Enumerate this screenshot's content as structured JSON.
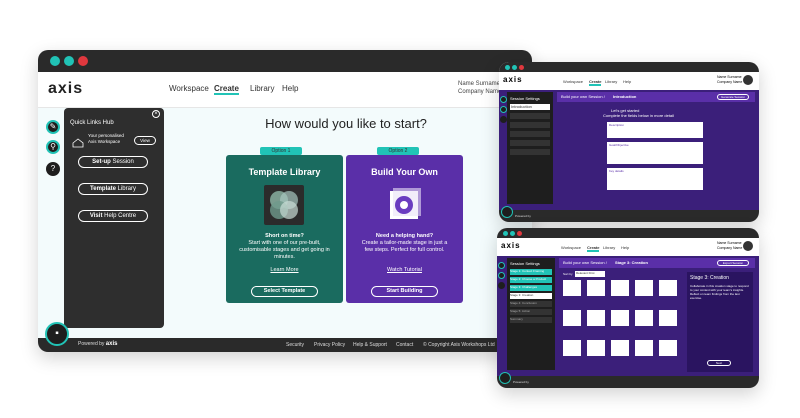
{
  "colors": {
    "teal": "#21c3b6",
    "dark": "#2a2a2a",
    "green_card": "#1a6b5f",
    "purple_card": "#5a2fa8",
    "purple_bg": "#3b1f7a",
    "light_bg": "#f3fbfc"
  },
  "main": {
    "brand": "axis",
    "nav": [
      "Workspace",
      "Create",
      "Library",
      "Help"
    ],
    "user_name": "Name Surname",
    "company_name": "Company Name",
    "heading": "How would you like to start?",
    "sidebar": {
      "title": "Quick Links Hub",
      "workspace_text": "Your personalised Axis Workspace",
      "view_btn": "View",
      "setup_bold": "Set-up",
      "setup_rest": "Session",
      "template_bold": "Template",
      "template_rest": "Library",
      "visit_bold": "Visit",
      "visit_rest": "Help Centre"
    },
    "option1": {
      "tag": "Option 1",
      "title": "Template Library",
      "bold": "Short on time?",
      "text": "Start with one of our pre-built, customisable stages and get going in minutes.",
      "link": "Learn More",
      "button": "Select Template"
    },
    "option2": {
      "tag": "Option 2",
      "title": "Build Your Own",
      "bold": "Need a helping hand?",
      "text": "Create a tailor-made stage in just a few steps. Perfect for full control.",
      "link": "Watch Tutorial",
      "button": "Start Building"
    },
    "footer": {
      "powered": "Powered by",
      "links": [
        "Security",
        "Privacy Policy",
        "Help & Support",
        "Contact",
        "© Copyright Axis Workshops Ltd"
      ]
    }
  },
  "top_right": {
    "nav": [
      "Workspace",
      "Create",
      "Library",
      "Help"
    ],
    "user": "Name Surname",
    "company": "Company Name",
    "header_plain": "Build your own Session /",
    "header_bold": "Introduction",
    "header_btn": "Generate Session",
    "sidebar_title": "Session Settings",
    "sidebar_items": [
      "Introduction",
      "",
      "",
      "",
      "",
      ""
    ],
    "prompt_line1": "Let's get started",
    "prompt_line2": "Complete the fields below in more detail",
    "fields": [
      "Description",
      "Goal/Objective",
      "Key details"
    ],
    "footer_powered": "Powered by"
  },
  "bottom_right": {
    "nav": [
      "Workspace",
      "Create",
      "Library",
      "Help"
    ],
    "user": "Name Surname",
    "company": "Company Name",
    "header_plain": "Build your own Session /",
    "header_bold": "Stage 3: Creation",
    "header_btn": "Export Session",
    "sidebar_title": "Session Settings",
    "sidebar_items": [
      "Stage 1: Context Framing",
      "Stage 2: Choose a Product",
      "Stage 3: Challenges",
      "Stage 3: Creation",
      "Stage 4: Conclusion",
      "Stage 5: Action",
      "Summary"
    ],
    "filter_label": "Sort by",
    "filter_value": "Relevant First",
    "panel_title": "Stage 3: Creation",
    "panel_text": "Collaborate in this creation stage to respond to your context with your team's insights. Reflect on team findings from the last exercise.",
    "panel_btn": "Next",
    "footer_powered": "Powered by"
  }
}
